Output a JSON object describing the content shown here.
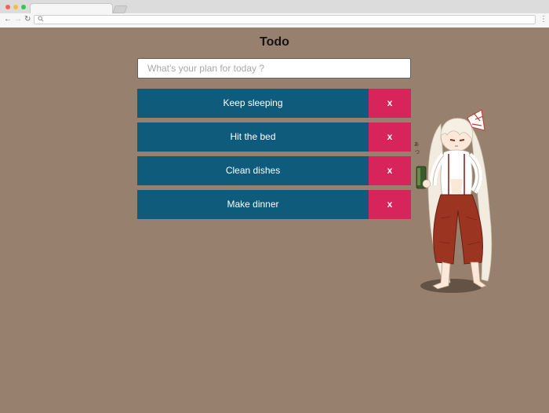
{
  "browser": {
    "nav_back": "←",
    "nav_forward": "→",
    "nav_reload": "↻",
    "menu": "⋮",
    "url": ""
  },
  "app": {
    "title": "Todo",
    "input_placeholder": "What's your plan for today ?",
    "input_value": "",
    "delete_label": "x",
    "todos": [
      {
        "text": "Keep sleeping"
      },
      {
        "text": "Hit the bed"
      },
      {
        "text": "Clean dishes"
      },
      {
        "text": "Make dinner"
      }
    ]
  },
  "colors": {
    "page_background": "#98806e",
    "todo_background": "#0e5b7b",
    "delete_background": "#d7245a",
    "input_border": "#5f5f5f"
  },
  "icons": {
    "mascot": "anime-character-illustration",
    "search": "magnifier-icon"
  }
}
